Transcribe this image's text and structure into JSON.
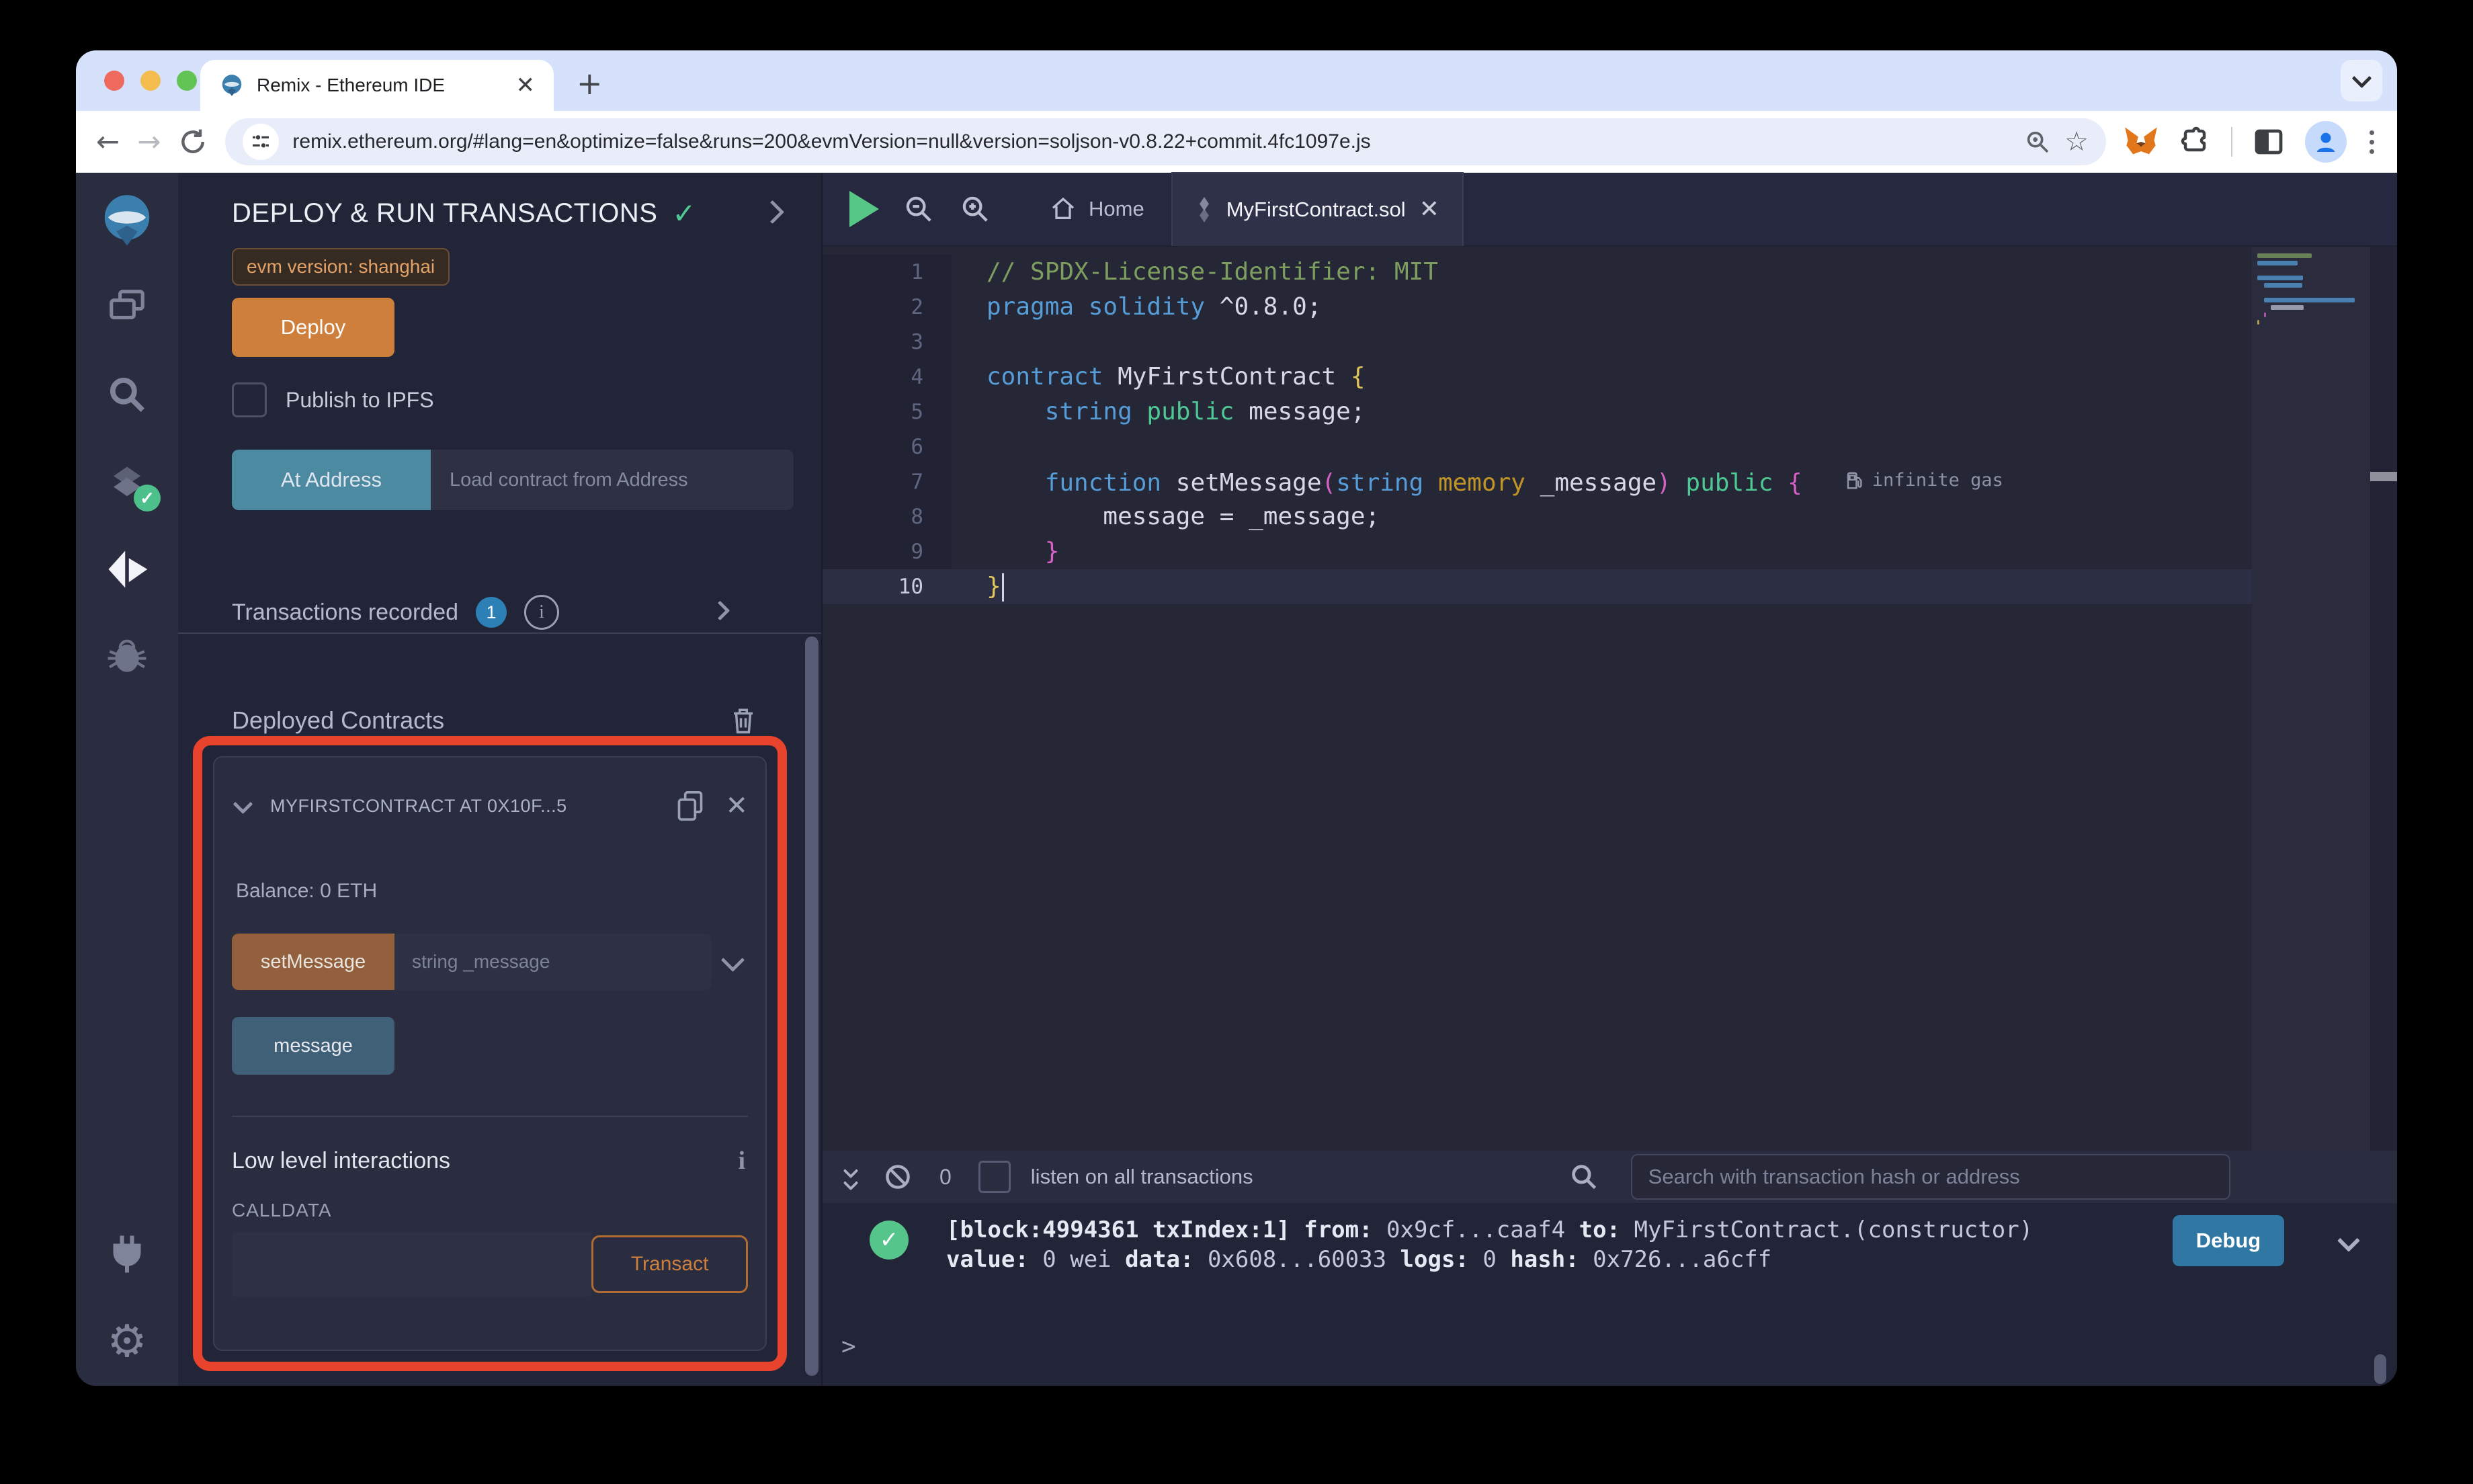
{
  "browser": {
    "tab_title": "Remix - Ethereum IDE",
    "url": "remix.ethereum.org/#lang=en&optimize=false&runs=200&evmVersion=null&version=soljson-v0.8.22+commit.4fc1097e.js",
    "new_tab_glyph": "+",
    "icons": [
      "back-arrow",
      "forward-arrow",
      "reload",
      "site-settings",
      "zoom",
      "bookmark-star",
      "metamask-fox",
      "extensions-puzzle",
      "sidebar-toggle",
      "profile-avatar",
      "kebab-menu",
      "tab-list-chevron"
    ]
  },
  "iconbar": {
    "icons": [
      "remix-logo",
      "file-explorer",
      "search",
      "solidity-compiler",
      "deploy-and-run",
      "debugger",
      "plugin-manager",
      "settings-gear"
    ]
  },
  "side_panel": {
    "title": "DEPLOY & RUN TRANSACTIONS",
    "evm_badge": "evm version: shanghai",
    "deploy_label": "Deploy",
    "publish_label": "Publish to IPFS",
    "at_address_label": "At Address",
    "at_address_placeholder": "Load contract from Address",
    "transactions_recorded": "Transactions recorded",
    "transactions_count": "1",
    "info_glyph": "i",
    "deployed_contracts": "Deployed Contracts",
    "highlight_color": "#e8432d",
    "contract": {
      "name": "MYFIRSTCONTRACT AT 0X10F...5",
      "balance": "Balance: 0 ETH",
      "set_message_label": "setMessage",
      "set_message_placeholder": "string _message",
      "message_label": "message",
      "low_level_title": "Low level interactions",
      "low_level_info_glyph": "i",
      "calldata_label": "CALLDATA",
      "transact_label": "Transact"
    }
  },
  "editor": {
    "home_tab": "Home",
    "file_tab": "MyFirstContract.sol",
    "gas_annotation": "infinite gas",
    "code_lines": [
      {
        "n": "1",
        "segs": [
          {
            "t": "// SPDX-License-Identifier: MIT",
            "c": "com"
          }
        ]
      },
      {
        "n": "2",
        "segs": [
          {
            "t": "pragma solidity ",
            "c": "kw"
          },
          {
            "t": "^0.8.0;",
            "c": "plain"
          }
        ]
      },
      {
        "n": "3",
        "segs": []
      },
      {
        "n": "4",
        "segs": [
          {
            "t": "contract ",
            "c": "kw"
          },
          {
            "t": "MyFirstContract ",
            "c": "plain"
          },
          {
            "t": "{",
            "c": "brace"
          }
        ]
      },
      {
        "n": "5",
        "segs": [
          {
            "t": "    ",
            "c": "plain"
          },
          {
            "t": "string ",
            "c": "kw"
          },
          {
            "t": "public ",
            "c": "green"
          },
          {
            "t": "message;",
            "c": "plain"
          }
        ]
      },
      {
        "n": "6",
        "segs": []
      },
      {
        "n": "7",
        "segs": [
          {
            "t": "    ",
            "c": "plain"
          },
          {
            "t": "function ",
            "c": "kw"
          },
          {
            "t": "setMessage",
            "c": "plain"
          },
          {
            "t": "(",
            "c": "pink"
          },
          {
            "t": "string ",
            "c": "kw"
          },
          {
            "t": "memory ",
            "c": "gold"
          },
          {
            "t": "_message",
            "c": "plain"
          },
          {
            "t": ") ",
            "c": "pink"
          },
          {
            "t": "public ",
            "c": "green"
          },
          {
            "t": "{",
            "c": "pink"
          }
        ],
        "gas": true
      },
      {
        "n": "8",
        "segs": [
          {
            "t": "        message = _message;",
            "c": "plain"
          }
        ]
      },
      {
        "n": "9",
        "segs": [
          {
            "t": "    ",
            "c": "plain"
          },
          {
            "t": "}",
            "c": "pink"
          }
        ]
      },
      {
        "n": "10",
        "segs": [
          {
            "t": "}",
            "c": "brace"
          }
        ],
        "current": true,
        "cursor": true
      }
    ]
  },
  "terminal": {
    "count": "0",
    "listen_label": "listen on all transactions",
    "search_placeholder": "Search with transaction hash or address",
    "log_line1_segments": [
      {
        "t": "[block:4994361 txIndex:1] ",
        "b": true
      },
      {
        "t": "from: ",
        "b": true
      },
      {
        "t": "0x9cf...caaf4 ",
        "b": false
      },
      {
        "t": "to: ",
        "b": true
      },
      {
        "t": "MyFirstContract.(constructor) ",
        "b": false
      }
    ],
    "log_line2_segments": [
      {
        "t": "value: ",
        "b": true
      },
      {
        "t": "0 wei ",
        "b": false
      },
      {
        "t": "data: ",
        "b": true
      },
      {
        "t": "0x608...60033 ",
        "b": false
      },
      {
        "t": "logs: ",
        "b": true
      },
      {
        "t": "0 ",
        "b": false
      },
      {
        "t": "hash: ",
        "b": true
      },
      {
        "t": "0x726...a6cff",
        "b": false
      }
    ],
    "debug_label": "Debug",
    "prompt": ">",
    "success_glyph": "✓",
    "debug_color": "#3077a3",
    "success_color": "#56c58b"
  }
}
